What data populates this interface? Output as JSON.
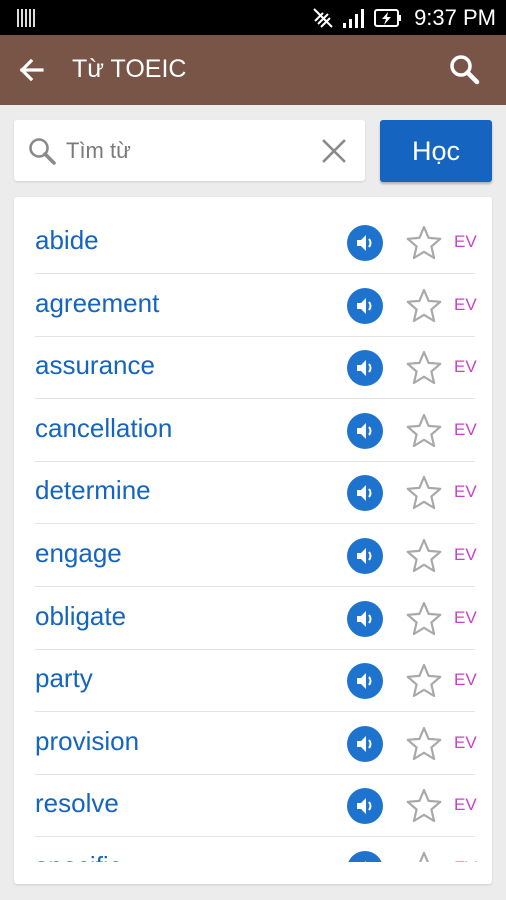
{
  "status_bar": {
    "time": "9:37 PM",
    "icons": [
      "barcode-icon",
      "mute-icon",
      "signal-icon",
      "battery-charging-icon"
    ]
  },
  "app_bar": {
    "title": "Từ TOEIC",
    "back_icon": "back-arrow-icon",
    "search_icon": "search-icon"
  },
  "search": {
    "placeholder": "Tìm từ",
    "value": "",
    "clear_icon": "close-icon"
  },
  "learn_button": {
    "label": "Học"
  },
  "colors": {
    "app_bar": "#795548",
    "accent": "#1565c0",
    "word_text": "#1565c0",
    "badge": "#c842c8"
  },
  "words": [
    {
      "word": "abide",
      "badge": "EV"
    },
    {
      "word": "agreement",
      "badge": "EV"
    },
    {
      "word": "assurance",
      "badge": "EV"
    },
    {
      "word": "cancellation",
      "badge": "EV"
    },
    {
      "word": "determine",
      "badge": "EV"
    },
    {
      "word": "engage",
      "badge": "EV"
    },
    {
      "word": "obligate",
      "badge": "EV"
    },
    {
      "word": "party",
      "badge": "EV"
    },
    {
      "word": "provision",
      "badge": "EV"
    },
    {
      "word": "resolve",
      "badge": "EV"
    },
    {
      "word": "specific",
      "badge": "EV"
    }
  ]
}
